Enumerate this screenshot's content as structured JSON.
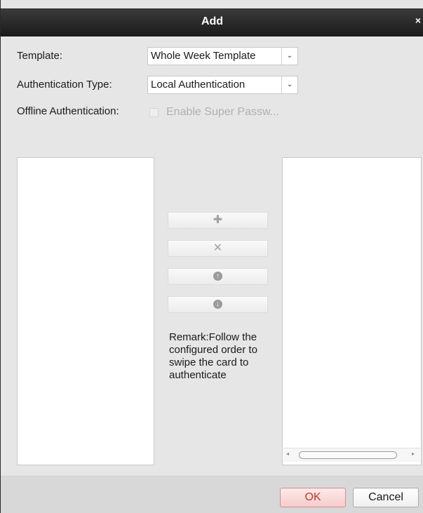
{
  "dialog": {
    "title": "Add",
    "close_glyph": "×"
  },
  "form": {
    "template_label": "Template:",
    "template_value": "Whole Week Template",
    "auth_type_label": "Authentication Type:",
    "auth_type_value": "Local Authentication",
    "offline_label": "Offline Authentication:",
    "offline_checkbox_label": "Enable Super Passw...",
    "offline_checkbox_checked": false,
    "dropdown_glyph": "⌄"
  },
  "middle": {
    "add_glyph": "✚",
    "remove_glyph": "✕",
    "up_glyph": "↑",
    "down_glyph": "↓",
    "remark": "Remark:Follow the configured order to swipe the card to authenticate"
  },
  "scrollbar": {
    "left_glyph": "◂",
    "right_glyph": "▸"
  },
  "footer": {
    "ok_label": "OK",
    "cancel_label": "Cancel"
  },
  "colors": {
    "titlebar": "#1a1a1a",
    "dialog_bg": "#e6e6e6",
    "ok_text": "#c0392b"
  }
}
